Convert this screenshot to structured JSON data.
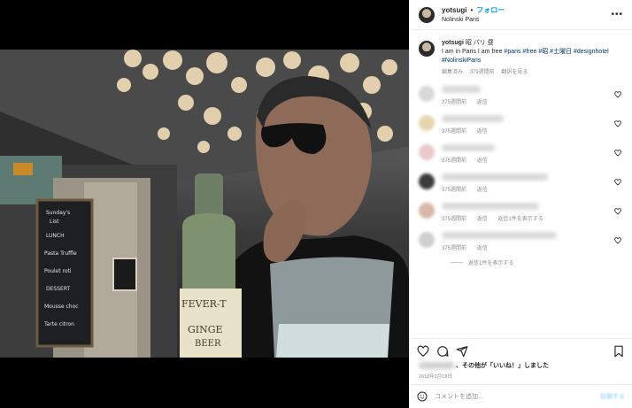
{
  "header": {
    "username": "yotsugi",
    "separator": "•",
    "follow_label": "フォロー",
    "location": "Nolinski Paris",
    "more_icon": "more-horizontal-icon"
  },
  "caption": {
    "username": "yotsugi",
    "text": "昭 パリ 昼",
    "body": "I am in Paris I am free",
    "hashtags": "#paris #free #昭 #土曜日 #designhotel #NolinskiParis",
    "edited": "編集済み",
    "time": "379週間前",
    "translate": "翻訳を見る"
  },
  "comments": [
    {
      "time": "375週間前",
      "reply": "返信",
      "avatar_color": "#d8d8d8",
      "blur_width": 44
    },
    {
      "time": "375週間前",
      "reply": "返信",
      "avatar_color": "#e6d6b0",
      "blur_width": 70
    },
    {
      "time": "375週間前",
      "reply": "返信",
      "avatar_color": "#e9c9c9",
      "blur_width": 60
    },
    {
      "time": "375週間前",
      "reply": "返信",
      "avatar_color": "#3a3a3a",
      "blur_width": 120
    },
    {
      "time": "375週間前",
      "reply": "返信",
      "avatar_color": "#d6b8a8",
      "blur_width": 110,
      "extra": "返信1件を表示する"
    },
    {
      "time": "375週間前",
      "reply": "返信",
      "avatar_color": "#cfcfcf",
      "blur_width": 130
    }
  ],
  "replies_label": "返信1件を表示する",
  "likes": {
    "suffix": "、その他が「いいね！」しました"
  },
  "date": "2018年2月18日",
  "add_comment": {
    "placeholder": "コメントを追加...",
    "post_label": "投稿する"
  },
  "colors": {
    "link": "#0095f6",
    "hashtag": "#00376b",
    "muted": "#8e8e8e"
  }
}
